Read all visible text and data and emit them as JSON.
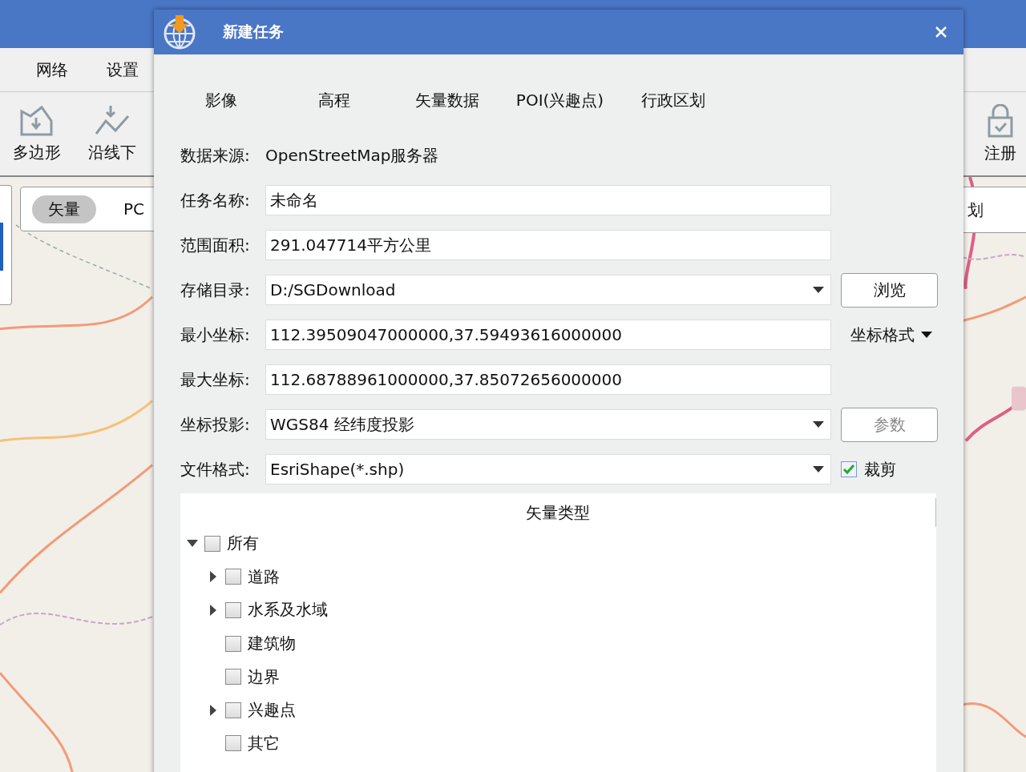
{
  "app": {
    "menu": [
      {
        "label": "网络"
      },
      {
        "label": "设置"
      }
    ],
    "toolbar": [
      {
        "label": "多边形",
        "kind": "polygon"
      },
      {
        "label": "沿线下",
        "kind": "line"
      }
    ],
    "toolbar_right": [
      {
        "label": "注册",
        "kind": "lock"
      }
    ],
    "map_tabs": [
      {
        "label": "矢量",
        "selected": true
      },
      {
        "label": "PC",
        "selected": false
      }
    ],
    "map_tab_right": "划"
  },
  "dialog": {
    "title": "新建任务",
    "tabs": [
      {
        "label": "影像"
      },
      {
        "label": "高程"
      },
      {
        "label": "矢量数据"
      },
      {
        "label": "POI(兴趣点)"
      },
      {
        "label": "行政区划"
      }
    ],
    "fields": [
      {
        "label": "数据来源:",
        "kind": "text",
        "value": "OpenStreetMap服务器"
      },
      {
        "label": "任务名称:",
        "kind": "input",
        "value": "未命名"
      },
      {
        "label": "范围面积:",
        "kind": "input",
        "value": "291.047714平方公里"
      },
      {
        "label": "存储目录:",
        "kind": "dropdown",
        "value": "D:/SGDownload",
        "side": {
          "kind": "button",
          "label": "浏览",
          "disabled": false
        }
      },
      {
        "label": "最小坐标:",
        "kind": "input",
        "value": "112.39509047000000,37.59493616000000",
        "side": {
          "kind": "menu",
          "label": "坐标格式"
        }
      },
      {
        "label": "最大坐标:",
        "kind": "input",
        "value": "112.68788961000000,37.85072656000000"
      },
      {
        "label": "坐标投影:",
        "kind": "dropdown",
        "value": "WGS84 经纬度投影",
        "side": {
          "kind": "button",
          "label": "参数",
          "disabled": true
        }
      },
      {
        "label": "文件格式:",
        "kind": "dropdown",
        "value": "EsriShape(*.shp)",
        "side": {
          "kind": "checkbox",
          "label": "裁剪",
          "checked": true
        }
      }
    ],
    "tree": {
      "header": "矢量类型",
      "items": [
        {
          "label": "所有",
          "checked": false,
          "expanded": true,
          "children": [
            {
              "label": "道路",
              "checked": false,
              "expanded": false
            },
            {
              "label": "水系及水域",
              "checked": false,
              "expanded": false
            },
            {
              "label": "建筑物",
              "checked": false
            },
            {
              "label": "边界",
              "checked": false
            },
            {
              "label": "兴趣点",
              "checked": false,
              "expanded": false
            },
            {
              "label": "其它",
              "checked": false
            }
          ]
        }
      ]
    }
  }
}
